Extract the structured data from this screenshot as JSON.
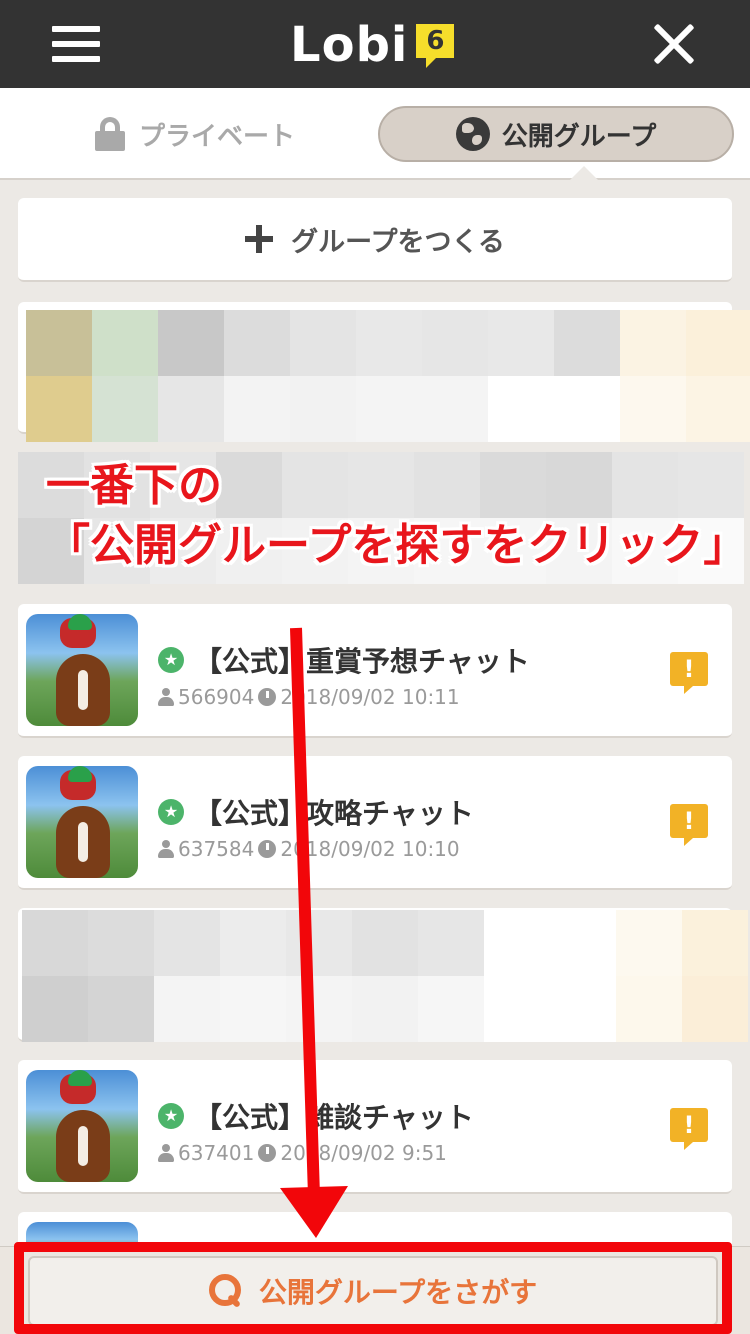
{
  "header": {
    "logo_text": "Lobi",
    "logo_badge": "6"
  },
  "tabs": {
    "private_label": "プライベート",
    "public_label": "公開グループ"
  },
  "create_group_label": "グループをつくる",
  "annotation": {
    "line1": "一番下の",
    "line2": "「公開グループを探すをクリック」"
  },
  "groups": [
    {
      "title": "【公式】重賞予想チャット",
      "members": "566904",
      "updated": "2018/09/02 10:11",
      "notice": "!"
    },
    {
      "title": "【公式】攻略チャット",
      "members": "637584",
      "updated": "2018/09/02 10:10",
      "notice": "!"
    },
    {
      "title": "【公式】雑談チャット",
      "members": "637401",
      "updated": "2018/09/02 9:51",
      "notice": "!"
    }
  ],
  "search_button_label": "公開グループをさがす",
  "colors": {
    "header_bg": "#333333",
    "accent_orange": "#e8743a",
    "annotation_red": "#e8161c",
    "notice_yellow": "#f2b226",
    "official_green": "#4cb46a"
  },
  "icons": [
    "menu-icon",
    "close-icon",
    "lock-icon",
    "globe-icon",
    "plus-icon",
    "star-icon",
    "user-icon",
    "clock-icon",
    "notice-icon",
    "search-icon"
  ]
}
